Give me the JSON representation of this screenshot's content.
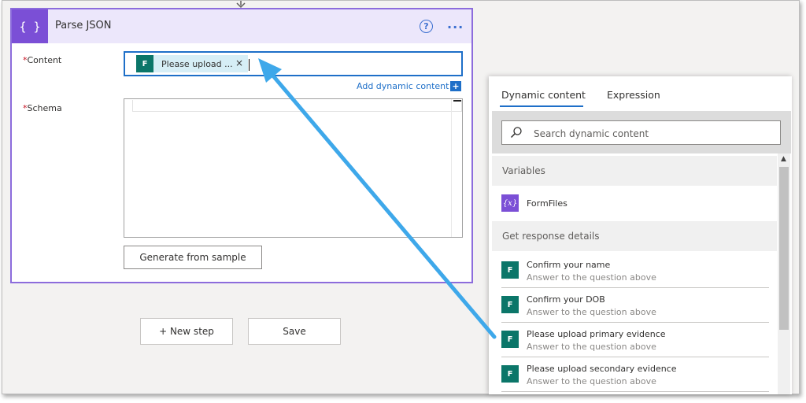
{
  "card": {
    "title": "Parse JSON",
    "header_icon": "{ }",
    "help_glyph": "?",
    "more_glyph": "···",
    "content_label": "Content",
    "required_mark": "*",
    "token_label": "Please upload ...",
    "token_close": "×",
    "add_dynamic_label": "Add dynamic content",
    "add_dynamic_plus": "+",
    "schema_label": "Schema",
    "generate_button": "Generate from sample"
  },
  "actions": {
    "new_step": "+ New step",
    "save": "Save"
  },
  "panel": {
    "tabs": [
      "Dynamic content",
      "Expression"
    ],
    "search_placeholder": "Search dynamic content",
    "sections": [
      {
        "header": "Variables"
      },
      {
        "header": "Get response details"
      }
    ],
    "variable_item": {
      "label": "FormFiles",
      "icon_glyph": "{x}"
    },
    "form_icon_glyph": "F",
    "items": [
      {
        "title": "Confirm your name",
        "subtitle": "Answer to the question above"
      },
      {
        "title": "Confirm your DOB",
        "subtitle": "Answer to the question above"
      },
      {
        "title": "Please upload primary evidence",
        "subtitle": "Answer to the question above"
      },
      {
        "title": "Please upload secondary evidence",
        "subtitle": "Answer to the question above"
      }
    ],
    "scroll_up_glyph": "▲"
  },
  "colors": {
    "accent_purple": "#7b4fd6",
    "forms_teal": "#0b7669",
    "link_blue": "#1e6fc8",
    "arrow_blue": "#3ea8ea"
  },
  "icons": {
    "connector": "chevron-down-icon",
    "header": "parse-json-icon",
    "forms": "microsoft-forms-icon",
    "variable": "variable-icon",
    "search": "search-icon"
  }
}
